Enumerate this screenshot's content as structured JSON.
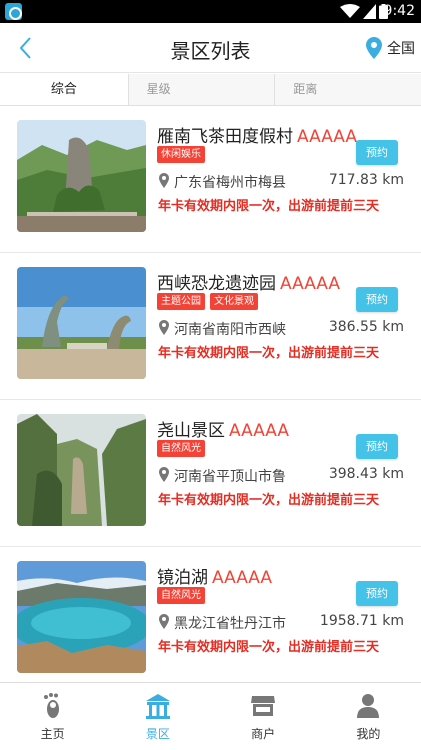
{
  "status_bar": {
    "time": "9:42"
  },
  "header": {
    "title": "景区列表",
    "location": "全国"
  },
  "tabs": [
    {
      "label": "综合",
      "active": true
    },
    {
      "label": "星级",
      "active": false
    },
    {
      "label": "距离",
      "active": false
    }
  ],
  "book_label": "预约",
  "spots": [
    {
      "name": "雁南飞茶田度假村",
      "grade": "AAAAA",
      "tags": [
        "休闲娱乐"
      ],
      "address": "广东省梅州市梅县",
      "distance": "717.83 km",
      "notice": "年卡有效期内限一次，出游前提前三天"
    },
    {
      "name": "西峡恐龙遗迹园",
      "grade": "AAAAA",
      "tags": [
        "主题公园",
        "文化景观"
      ],
      "address": "河南省南阳市西峡",
      "distance": "386.55 km",
      "notice": "年卡有效期内限一次，出游前提前三天"
    },
    {
      "name": "尧山景区",
      "grade": "AAAAA",
      "tags": [
        "自然风光"
      ],
      "address": "河南省平顶山市鲁",
      "distance": "398.43 km",
      "notice": "年卡有效期内限一次，出游前提前三天"
    },
    {
      "name": "镜泊湖",
      "grade": "AAAAA",
      "tags": [
        "自然风光"
      ],
      "address": "黑龙江省牡丹江市",
      "distance": "1958.71 km",
      "notice": "年卡有效期内限一次，出游前提前三天"
    }
  ],
  "bottom_nav": [
    {
      "label": "主页",
      "icon": "footprint-icon",
      "active": false
    },
    {
      "label": "景区",
      "icon": "scenic-gate-icon",
      "active": true
    },
    {
      "label": "商户",
      "icon": "shop-icon",
      "active": false
    },
    {
      "label": "我的",
      "icon": "person-icon",
      "active": false
    }
  ],
  "colors": {
    "accent": "#45c2e8",
    "grade": "#f44336",
    "notice": "#e52d23",
    "nav_active": "#3aaee0"
  }
}
